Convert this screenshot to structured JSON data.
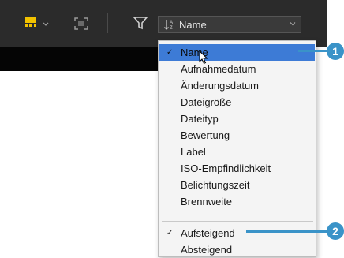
{
  "toolbar": {
    "sort_field": "Name"
  },
  "sort_menu": {
    "fields": [
      {
        "label": "Name",
        "checked": true
      },
      {
        "label": "Aufnahmedatum",
        "checked": false
      },
      {
        "label": "Änderungsdatum",
        "checked": false
      },
      {
        "label": "Dateigröße",
        "checked": false
      },
      {
        "label": "Dateityp",
        "checked": false
      },
      {
        "label": "Bewertung",
        "checked": false
      },
      {
        "label": "Label",
        "checked": false
      },
      {
        "label": "ISO-Empfindlichkeit",
        "checked": false
      },
      {
        "label": "Belichtungszeit",
        "checked": false
      },
      {
        "label": "Brennweite",
        "checked": false
      }
    ],
    "order": [
      {
        "label": "Aufsteigend",
        "checked": true
      },
      {
        "label": "Absteigend",
        "checked": false
      }
    ],
    "check_glyph": "✓"
  },
  "callouts": [
    "1",
    "2"
  ],
  "colors": {
    "toolbar_bg": "#2b2b2b",
    "accent_yellow": "#f2c200",
    "selection_blue": "#3d7bd6",
    "callout_blue": "#3a93c8"
  }
}
